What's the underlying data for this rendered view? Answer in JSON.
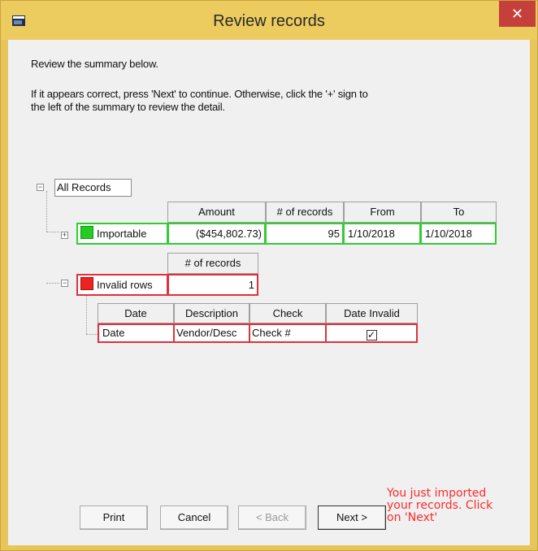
{
  "window": {
    "title": "Review records",
    "close_symbol": "✕"
  },
  "instructions": {
    "line1": "Review the summary below.",
    "line2": "If it appears correct, press 'Next' to continue.  Otherwise, click the '+' sign to",
    "line3": "the left of the summary to review the detail."
  },
  "tree": {
    "root_label": "All Records",
    "root_expander": "−",
    "importable": {
      "expander": "+",
      "label": "Importable",
      "status_color": "#22cc22",
      "headers": [
        "Amount",
        "# of records",
        "From",
        "To"
      ],
      "values": [
        "($454,802.73)",
        "95",
        "1/10/2018",
        "1/10/2018"
      ]
    },
    "invalid": {
      "expander": "−",
      "label": "Invalid rows",
      "status_color": "#ee2222",
      "header": "# of records",
      "value": "1",
      "detail_headers": [
        "Date",
        "Description",
        "Check",
        "Date Invalid"
      ],
      "detail_values": [
        "Date",
        "Vendor/Desc",
        "Check #"
      ],
      "date_invalid_checked": true,
      "check_symbol": "✓"
    }
  },
  "buttons": {
    "print": "Print",
    "cancel": "Cancel",
    "back": "< Back",
    "next": "Next >"
  },
  "note": {
    "line1": "You just imported",
    "line2": "your records. Click",
    "line3": "on 'Next'"
  }
}
